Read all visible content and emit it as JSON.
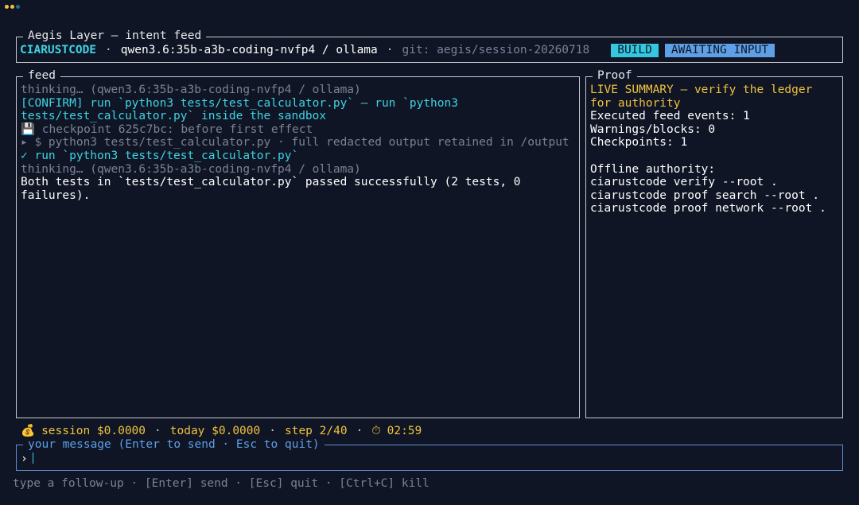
{
  "window": {
    "dot_colors": [
      "#f0c23e",
      "#f0c23e",
      "#1f6f8b"
    ]
  },
  "header": {
    "title": "Aegis Layer — intent feed",
    "brand": "CIARUSTCODE",
    "separator": "·",
    "model": "qwen3.6:35b-a3b-coding-nvfp4 / ollama",
    "git": "git: aegis/session-20260718",
    "mode_badge": "BUILD",
    "state_badge": "AWAITING INPUT"
  },
  "feed": {
    "title": "feed",
    "lines": [
      {
        "text": "thinking… (qwen3.6:35b-a3b-coding-nvfp4 / ollama)",
        "style": "dim"
      },
      {
        "text": "[CONFIRM] run `python3 tests/test_calculator.py` — run `python3 tests/test_calculator.py` inside the sandbox",
        "style": "cyan"
      },
      {
        "text": "💾 checkpoint 625c7bc: before first effect",
        "style": "dim"
      },
      {
        "text": "▸ $ python3 tests/test_calculator.py · full redacted output retained in /output",
        "style": "dim"
      },
      {
        "text": "✓ run `python3 tests/test_calculator.py`",
        "style": "cyan"
      },
      {
        "text": "thinking… (qwen3.6:35b-a3b-coding-nvfp4 / ollama)",
        "style": "dim"
      },
      {
        "text": "Both tests in `tests/test_calculator.py` passed successfully (2 tests, 0 failures).",
        "style": "white"
      }
    ]
  },
  "proof": {
    "title": "Proof",
    "lines": [
      {
        "text": "LIVE SUMMARY — verify the ledger for authority",
        "style": "yellow"
      },
      {
        "text": "Executed feed events: 1",
        "style": "white"
      },
      {
        "text": "Warnings/blocks: 0",
        "style": "white"
      },
      {
        "text": "Checkpoints: 1",
        "style": "white"
      },
      {
        "text": " ",
        "style": "white"
      },
      {
        "text": "Offline authority:",
        "style": "white"
      },
      {
        "text": "ciarustcode verify --root .",
        "style": "white"
      },
      {
        "text": "ciarustcode proof search --root .",
        "style": "white"
      },
      {
        "text": "ciarustcode proof network --root .",
        "style": "white"
      }
    ]
  },
  "status": {
    "session_icon": "💰",
    "session": "session $0.0000",
    "today": "today $0.0000",
    "step": "step 2/40",
    "timer_icon": "⏱",
    "timer": "02:59",
    "separator": "·"
  },
  "input": {
    "label": "your message (Enter to send · Esc to quit)",
    "prompt": "›",
    "value": ""
  },
  "hint": "type a follow-up · [Enter] send · [Esc] quit · [Ctrl+C] kill"
}
